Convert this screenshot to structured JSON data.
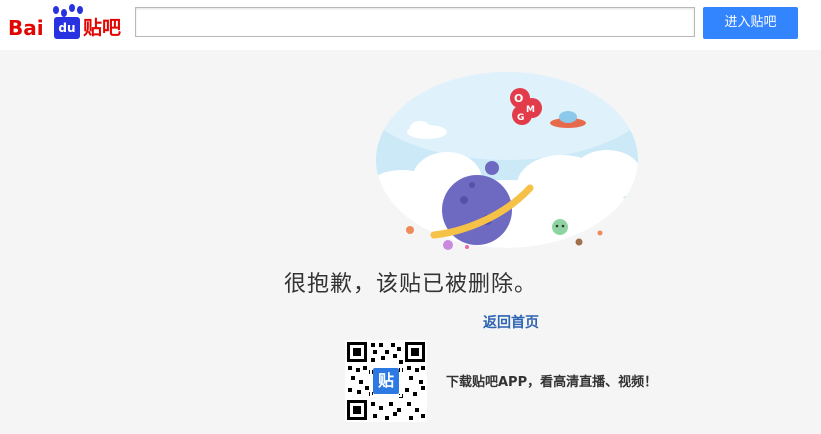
{
  "header": {
    "logo": {
      "bai": "Bai",
      "du": "du",
      "tieba": "贴吧"
    },
    "search": {
      "value": "",
      "placeholder": ""
    },
    "enter_button": "进入贴吧"
  },
  "illustration": {
    "omg_text": "OMG"
  },
  "main": {
    "message": "很抱歉，该贴已被删除。",
    "home_link": "返回首页",
    "qr_badge": "贴",
    "app_promo": "下载贴吧APP，看高清直播、视频！"
  },
  "colors": {
    "brand_red": "#e10602",
    "brand_blue": "#2932e1",
    "button_blue": "#3385ff",
    "link_blue": "#2d64b3"
  }
}
